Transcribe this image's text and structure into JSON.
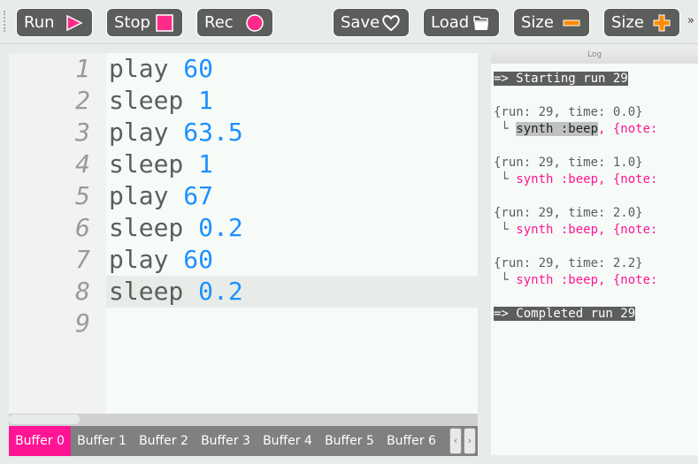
{
  "toolbar": {
    "buttons": [
      {
        "label": "Run",
        "icon": "play-icon"
      },
      {
        "label": "Stop",
        "icon": "stop-icon"
      },
      {
        "label": "Rec",
        "icon": "record-icon"
      },
      {
        "label": "Save",
        "icon": "heart-icon"
      },
      {
        "label": "Load",
        "icon": "folder-icon"
      },
      {
        "label": "Size",
        "icon": "minus-icon"
      },
      {
        "label": "Size",
        "icon": "plus-icon"
      }
    ],
    "more": "»"
  },
  "colors": {
    "accent": "#ff1493",
    "button": "#5b5e5a",
    "number": "#1e90ff",
    "size_icon": "#ff8c00"
  },
  "editor": {
    "line_numbers": [
      "1",
      "2",
      "3",
      "4",
      "5",
      "6",
      "7",
      "8",
      "9"
    ],
    "lines": [
      {
        "kw": "play ",
        "num": "60"
      },
      {
        "kw": "sleep ",
        "num": "1"
      },
      {
        "kw": "play ",
        "num": "63.5"
      },
      {
        "kw": "sleep ",
        "num": "1"
      },
      {
        "kw": "play ",
        "num": "67"
      },
      {
        "kw": "sleep ",
        "num": "0.2"
      },
      {
        "kw": "play ",
        "num": "60"
      },
      {
        "kw": "sleep ",
        "num": "0.2"
      }
    ]
  },
  "tabs": [
    "Buffer 0",
    "Buffer 1",
    "Buffer 2",
    "Buffer 3",
    "Buffer 4",
    "Buffer 5",
    "Buffer 6"
  ],
  "tab_nav": {
    "prev": "‹",
    "next": "›"
  },
  "log": {
    "title": "Log",
    "start": "=> Starting run 29",
    "end": "=> Completed run 29",
    "entries": [
      {
        "head": "{run: 29, time: 0.0}"
      },
      {
        "head": "{run: 29, time: 1.0}"
      },
      {
        "head": "{run: 29, time: 2.0}"
      },
      {
        "head": "{run: 29, time: 2.2}"
      }
    ],
    "branch": " └ ",
    "synth": "synth :beep",
    "rest": ", {note:"
  }
}
